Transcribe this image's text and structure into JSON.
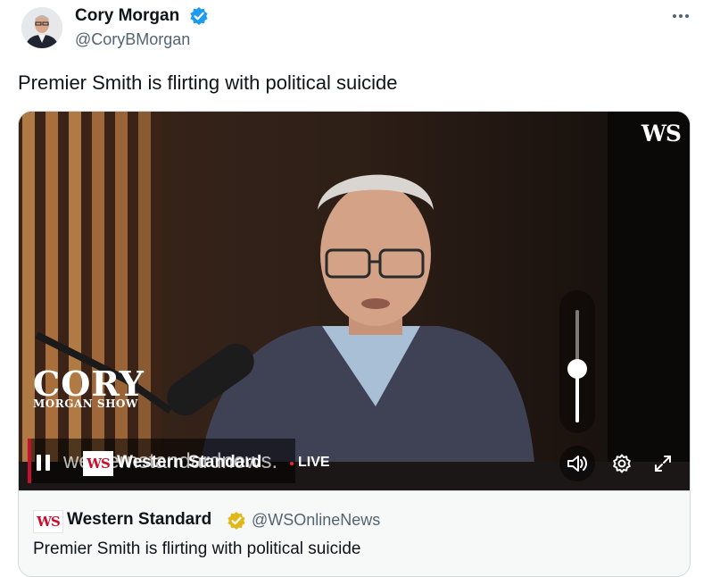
{
  "author": {
    "name": "Cory Morgan",
    "handle": "@CoryBMorgan",
    "verified_color": "#1d9bf0"
  },
  "tweet": {
    "text": "Premier Smith is flirting with political suicide"
  },
  "more_icon": "more-horizontal-icon",
  "media": {
    "corner_logo": "WS",
    "show_title": "CORY",
    "show_subtitle": "MORGAN SHOW",
    "volume_level": 0.48,
    "lower_third": {
      "ghost_text": "westernstandardnews.",
      "badge": "WS",
      "name": "Western Standard"
    },
    "live_label": "LIVE",
    "controls": [
      "pause-icon",
      "volume-icon",
      "settings-icon",
      "fullscreen-icon"
    ]
  },
  "quoted_source": {
    "logo": "WS",
    "name": "Western Standard",
    "badge_color": "#e2b719",
    "handle": "@WSOnlineNews",
    "text": "Premier Smith is flirting with political suicide"
  }
}
